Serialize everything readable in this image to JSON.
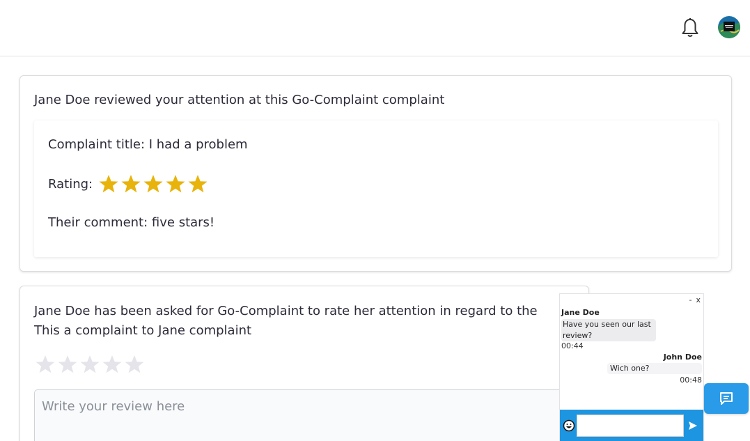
{
  "header": {
    "notification_icon": "bell-icon",
    "avatar_icon": "user-avatar"
  },
  "review_card": {
    "heading": "Jane Doe reviewed your attention at this Go-Complaint complaint",
    "complaint_title": "Complaint title: I had a problem",
    "rating_label": "Rating:",
    "rating": 5,
    "rating_max": 5,
    "comment": "Their comment: five stars!",
    "star_color": "#e8b30a"
  },
  "rate_card": {
    "heading": "Jane Doe has been asked for Go-Complaint to rate her attention in regard to the This a complaint to Jane complaint",
    "rating": 0,
    "rating_max": 5,
    "review_placeholder": "Write your review here",
    "empty_star_color": "#e4e4ea"
  },
  "chat": {
    "controls": {
      "minimize": "-",
      "close": "x"
    },
    "messages": [
      {
        "sender": "Jane Doe",
        "text": "Have you seen our last review?",
        "time": "00:44",
        "side": "left"
      },
      {
        "sender": "John Doe",
        "text": "Wich one?",
        "time": "00:48",
        "side": "right"
      }
    ],
    "input_value": "",
    "emoji_icon": "emoji-icon",
    "send_icon": "send-icon",
    "footer_color": "#1e95e0"
  },
  "chat_toggle": {
    "icon": "chat-bubble-icon",
    "color": "#2a9be8"
  }
}
